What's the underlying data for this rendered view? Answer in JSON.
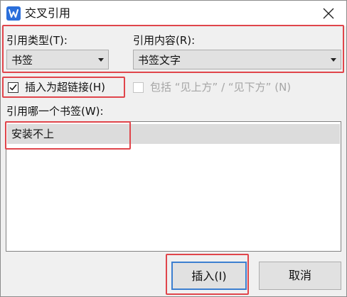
{
  "window": {
    "title": "交叉引用",
    "icon": "wps-writer-icon"
  },
  "reference_type": {
    "label": "引用类型(T):",
    "value": "书签"
  },
  "reference_content": {
    "label": "引用内容(R):",
    "value": "书签文字"
  },
  "options": {
    "insert_hyperlink": {
      "label": "插入为超链接(H)",
      "checked": true
    },
    "include_position": {
      "label": "包括 “见上方” / “见下方” (N)",
      "checked": false,
      "enabled": false
    }
  },
  "bookmark_list": {
    "label": "引用哪一个书签(W):",
    "items": [
      "安装不上"
    ],
    "selected": 0
  },
  "buttons": {
    "insert": "插入(I)",
    "cancel": "取消"
  },
  "annotation_color": "#e0454b"
}
